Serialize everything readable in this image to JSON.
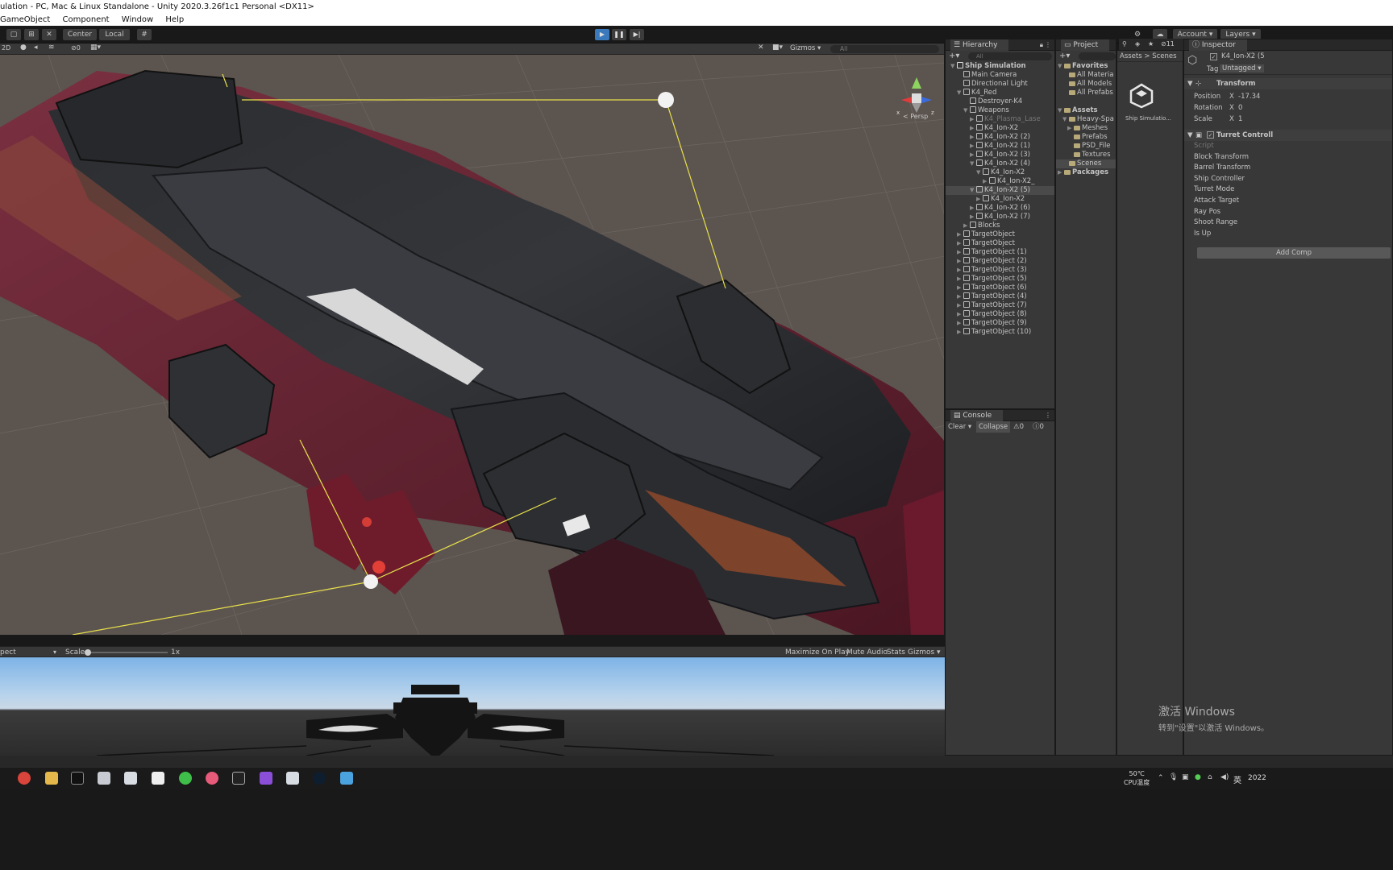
{
  "window": {
    "title": "ulation - PC, Mac & Linux Standalone - Unity 2020.3.26f1c1 Personal <DX11>",
    "menu": [
      "GameObject",
      "Component",
      "Window",
      "Help"
    ]
  },
  "toolbar": {
    "pivot": "Center",
    "space": "Local",
    "account": "Account",
    "layers": "Layers",
    "play_icon": "play-icon",
    "pause_icon": "pause-icon",
    "step_icon": "step-icon"
  },
  "scene": {
    "mode_2d": "2D",
    "fx_count": "0",
    "gizmos": "Gizmos",
    "search_placeholder": "All",
    "persp": "< Persp"
  },
  "game": {
    "aspect": "pect",
    "scale_label": "Scale",
    "scale_value": "1x",
    "maximize": "Maximize On Play",
    "mute": "Mute Audio",
    "stats": "Stats",
    "gizmos": "Gizmos"
  },
  "hierarchy": {
    "title": "Hierarchy",
    "search_placeholder": "All",
    "items": [
      {
        "label": "Ship Simulation",
        "depth": 0,
        "arrow": "▼",
        "bold": true
      },
      {
        "label": "Main Camera",
        "depth": 1,
        "arrow": ""
      },
      {
        "label": "Directional Light",
        "depth": 1,
        "arrow": ""
      },
      {
        "label": "K4_Red",
        "depth": 1,
        "arrow": "▼"
      },
      {
        "label": "Destroyer-K4",
        "depth": 2,
        "arrow": ""
      },
      {
        "label": "Weapons",
        "depth": 2,
        "arrow": "▼"
      },
      {
        "label": "K4_Plasma_Lase",
        "depth": 3,
        "arrow": "▶",
        "dim": true
      },
      {
        "label": "K4_Ion-X2",
        "depth": 3,
        "arrow": "▶"
      },
      {
        "label": "K4_Ion-X2 (2)",
        "depth": 3,
        "arrow": "▶"
      },
      {
        "label": "K4_Ion-X2 (1)",
        "depth": 3,
        "arrow": "▶"
      },
      {
        "label": "K4_Ion-X2 (3)",
        "depth": 3,
        "arrow": "▶"
      },
      {
        "label": "K4_Ion-X2 (4)",
        "depth": 3,
        "arrow": "▼"
      },
      {
        "label": "K4_Ion-X2",
        "depth": 4,
        "arrow": "▼"
      },
      {
        "label": "K4_Ion-X2_",
        "depth": 5,
        "arrow": "▶"
      },
      {
        "label": "K4_Ion-X2 (5)",
        "depth": 3,
        "arrow": "▼",
        "selected": true
      },
      {
        "label": "K4_Ion-X2",
        "depth": 4,
        "arrow": "▶"
      },
      {
        "label": "K4_Ion-X2 (6)",
        "depth": 3,
        "arrow": "▶"
      },
      {
        "label": "K4_Ion-X2 (7)",
        "depth": 3,
        "arrow": "▶"
      },
      {
        "label": "Blocks",
        "depth": 2,
        "arrow": "▶"
      },
      {
        "label": "TargetObject",
        "depth": 1,
        "arrow": "▶"
      },
      {
        "label": "TargetObject",
        "depth": 1,
        "arrow": "▶"
      },
      {
        "label": "TargetObject (1)",
        "depth": 1,
        "arrow": "▶"
      },
      {
        "label": "TargetObject (2)",
        "depth": 1,
        "arrow": "▶"
      },
      {
        "label": "TargetObject (3)",
        "depth": 1,
        "arrow": "▶"
      },
      {
        "label": "TargetObject (5)",
        "depth": 1,
        "arrow": "▶"
      },
      {
        "label": "TargetObject (6)",
        "depth": 1,
        "arrow": "▶"
      },
      {
        "label": "TargetObject (4)",
        "depth": 1,
        "arrow": "▶"
      },
      {
        "label": "TargetObject (7)",
        "depth": 1,
        "arrow": "▶"
      },
      {
        "label": "TargetObject (8)",
        "depth": 1,
        "arrow": "▶"
      },
      {
        "label": "TargetObject (9)",
        "depth": 1,
        "arrow": "▶"
      },
      {
        "label": "TargetObject (10)",
        "depth": 1,
        "arrow": "▶"
      }
    ]
  },
  "project": {
    "title": "Project",
    "hidden_count": "11",
    "breadcrumb": [
      "Assets",
      "Scenes"
    ],
    "tree": [
      {
        "label": "Favorites",
        "depth": 0,
        "arrow": "▼",
        "bold": true
      },
      {
        "label": "All Materia",
        "depth": 1,
        "arrow": ""
      },
      {
        "label": "All Models",
        "depth": 1,
        "arrow": ""
      },
      {
        "label": "All Prefabs",
        "depth": 1,
        "arrow": ""
      },
      {
        "label": "",
        "depth": 0,
        "arrow": ""
      },
      {
        "label": "Assets",
        "depth": 0,
        "arrow": "▼",
        "bold": true
      },
      {
        "label": "Heavy-Spa",
        "depth": 1,
        "arrow": "▼"
      },
      {
        "label": "Meshes",
        "depth": 2,
        "arrow": "▶"
      },
      {
        "label": "Prefabs",
        "depth": 2,
        "arrow": ""
      },
      {
        "label": "PSD_File",
        "depth": 2,
        "arrow": ""
      },
      {
        "label": "Textures",
        "depth": 2,
        "arrow": ""
      },
      {
        "label": "Scenes",
        "depth": 1,
        "arrow": "",
        "selected": true
      },
      {
        "label": "Packages",
        "depth": 0,
        "arrow": "▶",
        "bold": true
      }
    ],
    "asset_name": "Ship Simulatio..."
  },
  "console": {
    "title": "Console",
    "clear": "Clear",
    "collapse": "Collapse",
    "warn_count": "0",
    "err_count": "0"
  },
  "inspector": {
    "title": "Inspector",
    "object_name": "K4_Ion-X2 (5",
    "tag_label": "Tag",
    "tag_value": "Untagged",
    "transform_title": "Transform",
    "position_label": "Position",
    "position_x": "-17.34",
    "rotation_label": "Rotation",
    "rotation_x": "0",
    "scale_label": "Scale",
    "scale_x": "1",
    "component_title": "Turret Controll",
    "fields": [
      "Script",
      "Block Transform",
      "Barrel Transform",
      "Ship Controller",
      "Turret Mode",
      "Attack Target",
      "Ray Pos",
      "Shoot Range",
      "Is Up"
    ],
    "add_component": "Add Comp"
  },
  "watermark": {
    "line1": "激活 Windows",
    "line2": "转到\"设置\"以激活 Windows。"
  },
  "tray": {
    "temp": "50℃",
    "temp_label": "CPU温度",
    "ime": "英",
    "clock": "2022"
  },
  "colors": {
    "accent_blue": "#3a79bb",
    "panel_bg": "#383838",
    "hull_red": "#6b2230",
    "gizmo_yellow": "#e8e04a"
  }
}
